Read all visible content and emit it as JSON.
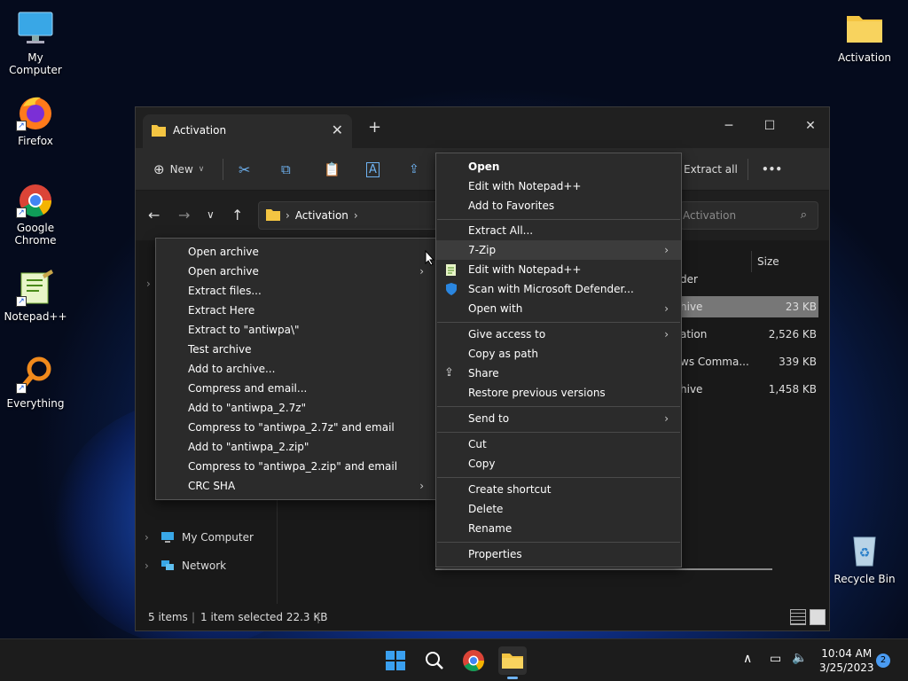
{
  "desktop": {
    "icons": [
      {
        "label": "My Computer"
      },
      {
        "label": "Firefox"
      },
      {
        "label": "Google Chrome"
      },
      {
        "label": "Notepad++"
      },
      {
        "label": "Everything"
      },
      {
        "label": "Activation"
      },
      {
        "label": "Recycle Bin"
      }
    ]
  },
  "window": {
    "tab_title": "Activation",
    "toolbar": {
      "new_label": "New",
      "extract_all_label": "Extract all",
      "more_label": "•••"
    },
    "address": {
      "path": "Activation"
    },
    "search_placeholder": "Search Activation",
    "search_visible": "Activation",
    "nav_pane": [
      {
        "label": "My Computer"
      },
      {
        "label": "Network"
      }
    ],
    "columns": {
      "size": "Size"
    },
    "rows": [
      {
        "name": "der",
        "size": ""
      },
      {
        "name": "hive",
        "size": "23 KB"
      },
      {
        "name": "ation",
        "size": "2,526 KB"
      },
      {
        "name": "ws Comma...",
        "size": "339 KB"
      },
      {
        "name": "hive",
        "size": "1,458 KB"
      }
    ],
    "status": {
      "items": "5 items",
      "selected": "1 item selected  22.3 KB"
    }
  },
  "main_menu": {
    "items": [
      "Open",
      "Edit with Notepad++",
      "Add to Favorites",
      "Extract All...",
      "7-Zip",
      "Edit with Notepad++",
      "Scan with Microsoft Defender...",
      "Open with",
      "Give access to",
      "Copy as path",
      "Share",
      "Restore previous versions",
      "Send to",
      "Cut",
      "Copy",
      "Create shortcut",
      "Delete",
      "Rename",
      "Properties"
    ]
  },
  "zip_menu": {
    "items": [
      "Open archive",
      "Open archive",
      "Extract files...",
      "Extract Here",
      "Extract to \"antiwpa\\\"",
      "Test archive",
      "Add to archive...",
      "Compress and email...",
      "Add to \"antiwpa_2.7z\"",
      "Compress to \"antiwpa_2.7z\" and email",
      "Add to \"antiwpa_2.zip\"",
      "Compress to \"antiwpa_2.zip\" and email",
      "CRC SHA"
    ]
  },
  "taskbar": {
    "time": "10:04 AM",
    "date": "3/25/2023",
    "notification_count": "2"
  },
  "icons": {
    "folder_color": "#f4c542",
    "accent": "#4a9bf2"
  }
}
